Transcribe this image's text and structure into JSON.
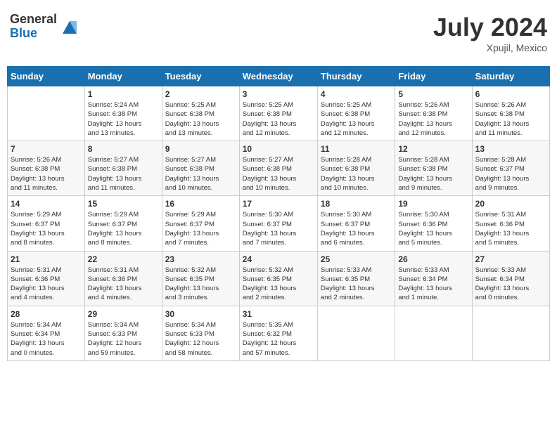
{
  "header": {
    "logo_general": "General",
    "logo_blue": "Blue",
    "month_title": "July 2024",
    "location": "Xpujil, Mexico"
  },
  "columns": [
    "Sunday",
    "Monday",
    "Tuesday",
    "Wednesday",
    "Thursday",
    "Friday",
    "Saturday"
  ],
  "weeks": [
    [
      {
        "day": "",
        "info": ""
      },
      {
        "day": "1",
        "info": "Sunrise: 5:24 AM\nSunset: 6:38 PM\nDaylight: 13 hours\nand 13 minutes."
      },
      {
        "day": "2",
        "info": "Sunrise: 5:25 AM\nSunset: 6:38 PM\nDaylight: 13 hours\nand 13 minutes."
      },
      {
        "day": "3",
        "info": "Sunrise: 5:25 AM\nSunset: 6:38 PM\nDaylight: 13 hours\nand 12 minutes."
      },
      {
        "day": "4",
        "info": "Sunrise: 5:25 AM\nSunset: 6:38 PM\nDaylight: 13 hours\nand 12 minutes."
      },
      {
        "day": "5",
        "info": "Sunrise: 5:26 AM\nSunset: 6:38 PM\nDaylight: 13 hours\nand 12 minutes."
      },
      {
        "day": "6",
        "info": "Sunrise: 5:26 AM\nSunset: 6:38 PM\nDaylight: 13 hours\nand 11 minutes."
      }
    ],
    [
      {
        "day": "7",
        "info": "Sunrise: 5:26 AM\nSunset: 6:38 PM\nDaylight: 13 hours\nand 11 minutes."
      },
      {
        "day": "8",
        "info": "Sunrise: 5:27 AM\nSunset: 6:38 PM\nDaylight: 13 hours\nand 11 minutes."
      },
      {
        "day": "9",
        "info": "Sunrise: 5:27 AM\nSunset: 6:38 PM\nDaylight: 13 hours\nand 10 minutes."
      },
      {
        "day": "10",
        "info": "Sunrise: 5:27 AM\nSunset: 6:38 PM\nDaylight: 13 hours\nand 10 minutes."
      },
      {
        "day": "11",
        "info": "Sunrise: 5:28 AM\nSunset: 6:38 PM\nDaylight: 13 hours\nand 10 minutes."
      },
      {
        "day": "12",
        "info": "Sunrise: 5:28 AM\nSunset: 6:38 PM\nDaylight: 13 hours\nand 9 minutes."
      },
      {
        "day": "13",
        "info": "Sunrise: 5:28 AM\nSunset: 6:37 PM\nDaylight: 13 hours\nand 9 minutes."
      }
    ],
    [
      {
        "day": "14",
        "info": "Sunrise: 5:29 AM\nSunset: 6:37 PM\nDaylight: 13 hours\nand 8 minutes."
      },
      {
        "day": "15",
        "info": "Sunrise: 5:29 AM\nSunset: 6:37 PM\nDaylight: 13 hours\nand 8 minutes."
      },
      {
        "day": "16",
        "info": "Sunrise: 5:29 AM\nSunset: 6:37 PM\nDaylight: 13 hours\nand 7 minutes."
      },
      {
        "day": "17",
        "info": "Sunrise: 5:30 AM\nSunset: 6:37 PM\nDaylight: 13 hours\nand 7 minutes."
      },
      {
        "day": "18",
        "info": "Sunrise: 5:30 AM\nSunset: 6:37 PM\nDaylight: 13 hours\nand 6 minutes."
      },
      {
        "day": "19",
        "info": "Sunrise: 5:30 AM\nSunset: 6:36 PM\nDaylight: 13 hours\nand 5 minutes."
      },
      {
        "day": "20",
        "info": "Sunrise: 5:31 AM\nSunset: 6:36 PM\nDaylight: 13 hours\nand 5 minutes."
      }
    ],
    [
      {
        "day": "21",
        "info": "Sunrise: 5:31 AM\nSunset: 6:36 PM\nDaylight: 13 hours\nand 4 minutes."
      },
      {
        "day": "22",
        "info": "Sunrise: 5:31 AM\nSunset: 6:36 PM\nDaylight: 13 hours\nand 4 minutes."
      },
      {
        "day": "23",
        "info": "Sunrise: 5:32 AM\nSunset: 6:35 PM\nDaylight: 13 hours\nand 3 minutes."
      },
      {
        "day": "24",
        "info": "Sunrise: 5:32 AM\nSunset: 6:35 PM\nDaylight: 13 hours\nand 2 minutes."
      },
      {
        "day": "25",
        "info": "Sunrise: 5:33 AM\nSunset: 6:35 PM\nDaylight: 13 hours\nand 2 minutes."
      },
      {
        "day": "26",
        "info": "Sunrise: 5:33 AM\nSunset: 6:34 PM\nDaylight: 13 hours\nand 1 minute."
      },
      {
        "day": "27",
        "info": "Sunrise: 5:33 AM\nSunset: 6:34 PM\nDaylight: 13 hours\nand 0 minutes."
      }
    ],
    [
      {
        "day": "28",
        "info": "Sunrise: 5:34 AM\nSunset: 6:34 PM\nDaylight: 13 hours\nand 0 minutes."
      },
      {
        "day": "29",
        "info": "Sunrise: 5:34 AM\nSunset: 6:33 PM\nDaylight: 12 hours\nand 59 minutes."
      },
      {
        "day": "30",
        "info": "Sunrise: 5:34 AM\nSunset: 6:33 PM\nDaylight: 12 hours\nand 58 minutes."
      },
      {
        "day": "31",
        "info": "Sunrise: 5:35 AM\nSunset: 6:32 PM\nDaylight: 12 hours\nand 57 minutes."
      },
      {
        "day": "",
        "info": ""
      },
      {
        "day": "",
        "info": ""
      },
      {
        "day": "",
        "info": ""
      }
    ]
  ]
}
